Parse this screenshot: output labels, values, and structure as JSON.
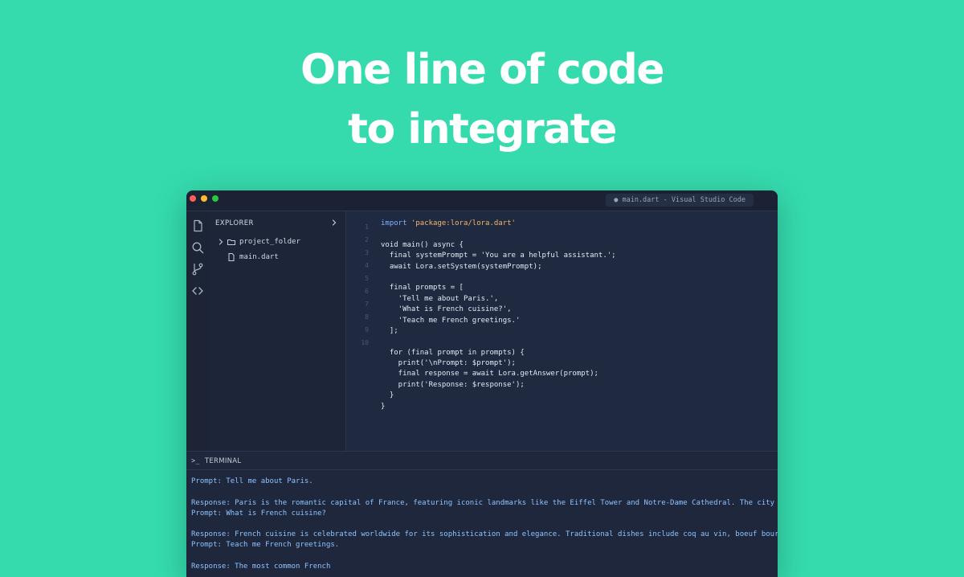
{
  "headline": {
    "line1": "One line of code",
    "line2": "to integrate"
  },
  "window": {
    "title": "● main.dart - Visual Studio Code",
    "traffic_lights": [
      "#ff5f57",
      "#febc2e",
      "#28c840"
    ]
  },
  "activity_bar": {
    "icons": [
      "files-icon",
      "search-icon",
      "source-control-icon",
      "code-icon"
    ]
  },
  "explorer": {
    "title": "EXPLORER",
    "folder": "project_folder",
    "file": "main.dart"
  },
  "editor": {
    "line_numbers": [
      "1",
      "2",
      "3",
      "4",
      "5",
      "6",
      "7",
      "8",
      "9",
      "10"
    ],
    "code": {
      "l1_kw": "import",
      "l1_str": "'package:lora/lora.dart'",
      "l2": "",
      "l3": "void main() async {",
      "l4": "  final systemPrompt = 'You are a helpful assistant.';",
      "l5": "  await Lora.setSystem(systemPrompt);",
      "l6": "",
      "l7": "  final prompts = [",
      "l8": "    'Tell me about Paris.',",
      "l9": "    'What is French cuisine?',",
      "l10": "    'Teach me French greetings.'",
      "l11": "  ];",
      "l12": "",
      "l13": "  for (final prompt in prompts) {",
      "l14": "    print('\\nPrompt: $prompt');",
      "l15": "    final response = await Lora.getAnswer(prompt);",
      "l16": "    print('Response: $response');",
      "l17": "  }",
      "l18": "}"
    }
  },
  "terminal": {
    "title": "TERMINAL",
    "prompt_symbol": ">_",
    "lines": [
      "Prompt: Tell me about Paris.",
      "Response: Paris is the romantic capital of France, featuring iconic landmarks like the Eiffel Tower and Notre-Dame Cathedral. The city enchant",
      "Prompt: What is French cuisine?",
      "Response: French cuisine is celebrated worldwide for its sophistication and elegance. Traditional dishes include coq au vin, boeuf bourguignor",
      "Prompt: Teach me French greetings.",
      "Response: The most common French"
    ]
  },
  "colors": {
    "background": "#35dbad",
    "editor_bg": "#1f2940",
    "keyword": "#7fb4ff",
    "string": "#f5b86a",
    "terminal_text": "#8fc3ff"
  }
}
